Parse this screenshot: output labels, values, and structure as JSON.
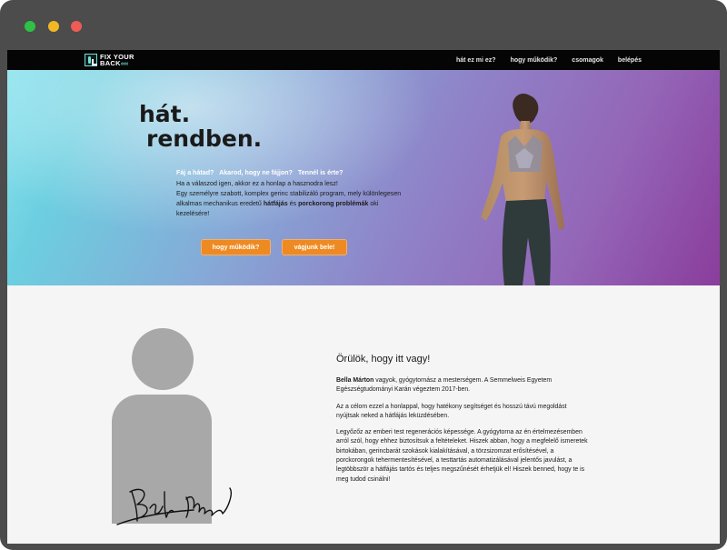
{
  "window": {
    "controls": [
      "close",
      "minimize",
      "zoom"
    ]
  },
  "nav": {
    "logo_line1": "FIX YOUR",
    "logo_line2": "BACK",
    "logo_arrows": "‹‹‹‹",
    "links": [
      "hát ez mi ez?",
      "hogy működik?",
      "csomagok",
      "belépés"
    ]
  },
  "hero": {
    "title_line1": "hát.",
    "title_line2": "rendben.",
    "questions": [
      "Fáj a hátad?",
      "Akarod, hogy ne fájjon?",
      "Tennél is érte?"
    ],
    "line1": "Ha a válaszod igen, akkor ez a honlap a hasznodra lesz!",
    "line2_pre": "Egy személyre szabott, komplex gerinc stabilizáló program, mely különlegesen alkalmas mechanikus eredetű ",
    "bold1": "hátfájás",
    "and": " és ",
    "bold2": "porckorong problémák",
    "line2_post": " oki kezelésére!",
    "button_how": "hogy működik?",
    "button_go": "vágjunk bele!"
  },
  "about": {
    "greeting": "Örülök, hogy itt vagy!",
    "name": "Bella Márton",
    "p1_rest": " vagyok, gyógytornász a mesterségem. A Semmelweis Egyetem Egészségtudományi Karán végeztem 2017-ben.",
    "p2": "Az a célom ezzel a honlappal, hogy hatékony segítséget és hosszú távú megoldást nyújtsak neked a hátfájás leküzdésében.",
    "p3": "Legyőzőz az emberi test regenerációs képessége. A gyógytorna az én értelmezésemben arról szól, hogy ehhez biztosítsuk a feltételeket. Hiszek abban, hogy a megfelelő ismeretek birtokában, gerincbarát szokások kialakításával, a törzsizomzat erősítésével, a porckorongok tehermentesítésével, a testtartás automatizálásával jelentős javulást, a legtöbbször a hátfájás tartós és teljes megszűnését érhetjük el! Hiszek benned, hogy te is meg tudod csinálni!"
  },
  "colors": {
    "accent_button": "#ee8a22",
    "navbar": "#050505",
    "logo_accent": "#6fe0d6",
    "avatar_placeholder": "#a8a8a8"
  }
}
